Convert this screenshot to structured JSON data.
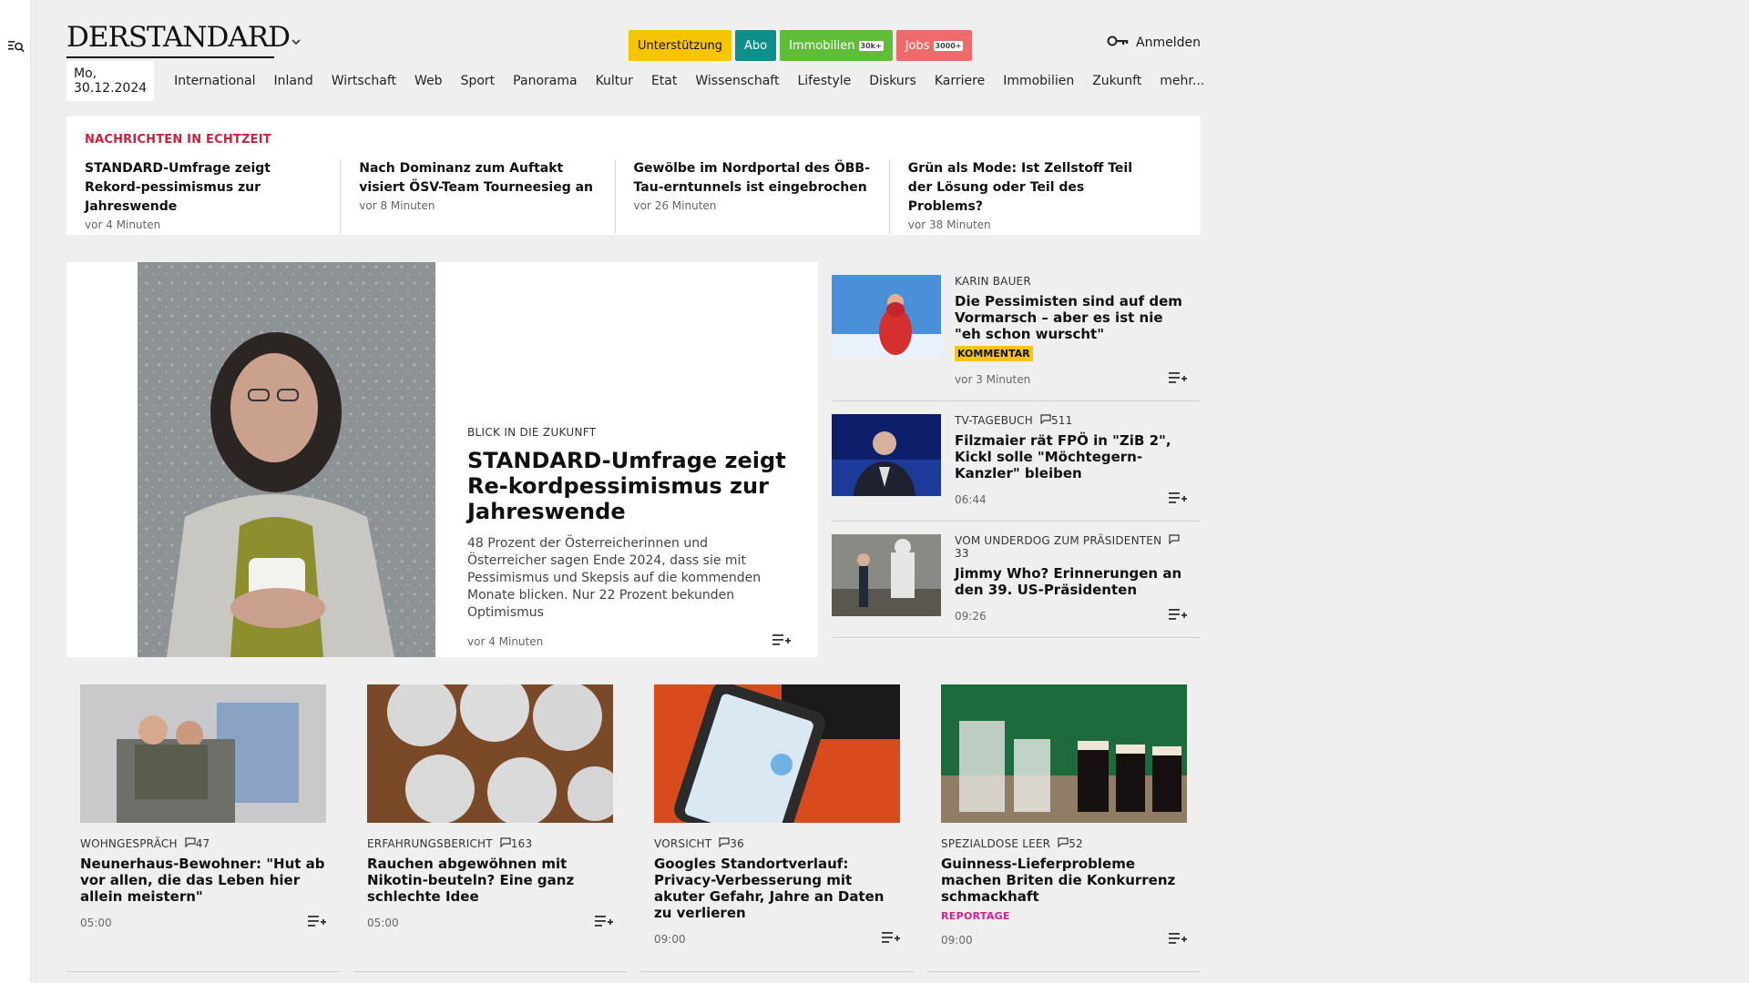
{
  "brand": {
    "logo": "DERSTANDARD"
  },
  "header": {
    "buttons": [
      {
        "label": "Unterstützung",
        "bg": "#f7c400",
        "fg": "#111111",
        "badge": ""
      },
      {
        "label": "Abo",
        "bg": "#0f8f8c",
        "fg": "#ffffff",
        "badge": ""
      },
      {
        "label": "Immobilien",
        "bg": "#5fbd3a",
        "fg": "#ffffff",
        "badge": "30k+"
      },
      {
        "label": "Jobs",
        "bg": "#ee6b6b",
        "fg": "#ffffff",
        "badge": "3000+"
      }
    ],
    "login": "Anmelden"
  },
  "nav": {
    "date": "Mo, 30.12.2024",
    "items": [
      "International",
      "Inland",
      "Wirtschaft",
      "Web",
      "Sport",
      "Panorama",
      "Kultur",
      "Etat",
      "Wissenschaft",
      "Lifestyle",
      "Diskurs",
      "Karriere",
      "Immobilien",
      "Zukunft",
      "mehr..."
    ]
  },
  "ticker": {
    "label": "NACHRICHTEN IN ECHTZEIT",
    "items": [
      {
        "title": "STANDARD-Umfrage zeigt Rekord-pessimismus zur Jahreswende",
        "time": "vor 4 Minuten"
      },
      {
        "title": "Nach Dominanz zum Auftakt visiert ÖSV-Team Tourneesieg an",
        "time": "vor 8 Minuten"
      },
      {
        "title": "Gewölbe im Nordportal des ÖBB-Tau-erntunnels ist eingebrochen",
        "time": "vor 26 Minuten"
      },
      {
        "title": "Grün als Mode: Ist Zellstoff Teil der Lösung oder Teil des Problems?",
        "time": "vor 38 Minuten"
      }
    ]
  },
  "hero": {
    "kicker": "BLICK IN DIE ZUKUNFT",
    "title": "STANDARD-Umfrage zeigt Re-kordpessimismus zur Jahreswende",
    "teaser": "48 Prozent der Österreicherinnen und Österreicher sagen Ende 2024, dass sie mit Pessimismus und Skepsis auf die kommenden Monate blicken. Nur 22 Prozent bekunden Optimismus",
    "time": "vor 4 Minuten"
  },
  "side": [
    {
      "kicker": "KARIN BAUER",
      "comments": "",
      "title": "Die Pessimisten sind auf dem Vormarsch – aber es ist nie \"eh schon wurscht\"",
      "pill": "KOMMENTAR",
      "time": "vor 3 Minuten"
    },
    {
      "kicker": "TV-TAGEBUCH",
      "comments": "511",
      "title": "Filzmaier rät FPÖ in \"ZiB 2\", Kickl solle \"Möchtegern-Kanzler\" bleiben",
      "pill": "",
      "time": "06:44"
    },
    {
      "kicker": "VOM UNDERDOG ZUM PRÄSIDENTEN",
      "comments": "33",
      "title": "Jimmy Who? Erinnerungen an den 39. US-Präsidenten",
      "pill": "",
      "time": "09:26"
    }
  ],
  "cards": [
    {
      "kicker": "WOHNGESPRÄCH",
      "comments": "47",
      "title": "Neunerhaus-Bewohner: \"Hut ab vor allen, die das Leben hier allein meistern\"",
      "tag": "",
      "time": "05:00"
    },
    {
      "kicker": "ERFAHRUNGSBERICHT",
      "comments": "163",
      "title": "Rauchen abgewöhnen mit Nikotin-beuteln? Eine ganz schlechte Idee",
      "tag": "",
      "time": "05:00"
    },
    {
      "kicker": "VORSICHT",
      "comments": "36",
      "title": "Googles Standortverlauf: Privacy-Verbesserung mit akuter Gefahr, Jahre an Daten zu verlieren",
      "tag": "",
      "time": "09:00"
    },
    {
      "kicker": "SPEZIALDOSE LEER",
      "comments": "52",
      "title": "Guinness-Lieferprobleme machen Briten die Konkurrenz schmackhaft",
      "tag": "REPORTAGE",
      "time": "09:00"
    }
  ]
}
